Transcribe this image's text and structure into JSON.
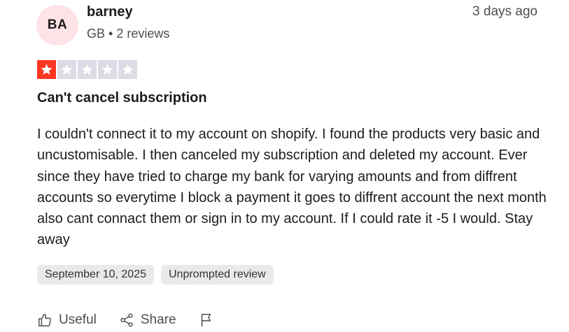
{
  "reviewer": {
    "initials": "BA",
    "name": "barney",
    "country": "GB",
    "separator": "•",
    "review_count": "2 reviews"
  },
  "posted_ago": "3 days ago",
  "rating": {
    "value": 1,
    "max": 5,
    "filled_color": "#ff3722",
    "empty_color": "#dcdce6"
  },
  "review": {
    "title": "Can't cancel subscription",
    "body": "I couldn't connect it to my account on shopify. I found the products very basic and uncustomisable. I then canceled my subscription and deleted my account. Ever since they have tried to charge my bank for varying amounts and from diffrent accounts so everytime I block a payment it goes to diffrent account the next month also cant connact them or sign in to my account. If I could rate it -5 I would. Stay away"
  },
  "tags": {
    "date": "September 10, 2025",
    "type": "Unprompted review"
  },
  "actions": {
    "useful_label": "Useful",
    "useful_icon": "thumbs-up-icon",
    "share_label": "Share",
    "share_icon": "share-icon",
    "report_icon": "flag-icon"
  }
}
